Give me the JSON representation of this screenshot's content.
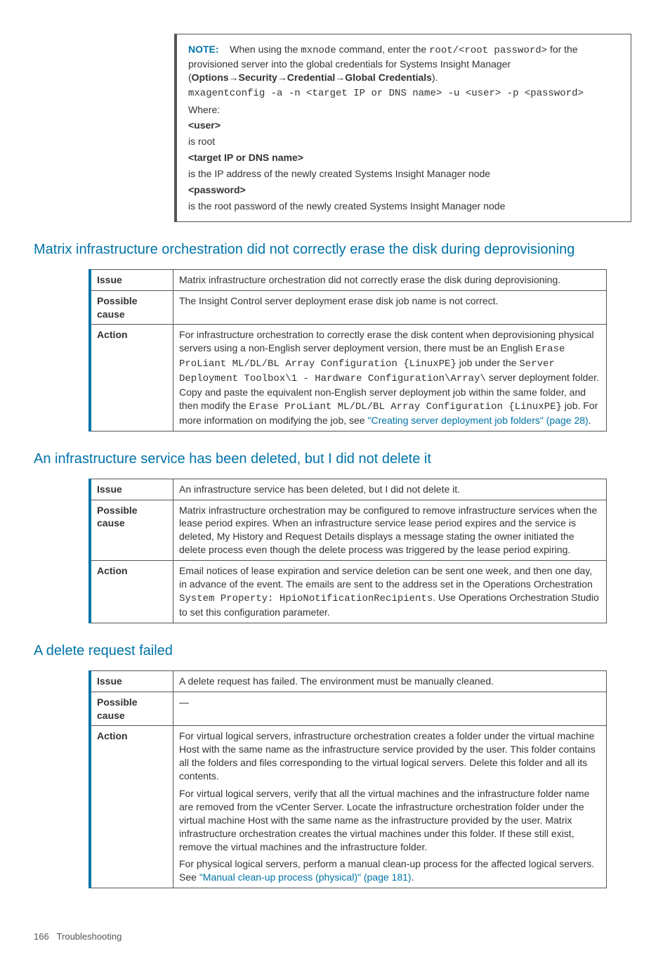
{
  "noteBox": {
    "notePrefix": "NOTE:",
    "noteLine1a": "When using the ",
    "noteCmd": "mxnode",
    "noteLine1b": " command, enter the ",
    "noteRoot": "root/<root password>",
    "noteLine1c": " for the provisioned server into the global credentials for Systems Insight Manager (",
    "notePath": "Options→Security→Credential→Global Credentials",
    "noteLine1d": ").",
    "cmd": "mxagentconfig -a -n <target IP or DNS name> -u <user> -p <password>",
    "where": "Where:",
    "userLabel": "<user>",
    "userDesc": "is root",
    "targetLabel": "<target IP or DNS name>",
    "targetDesc": "is the IP address of the newly created Systems Insight Manager node",
    "pwdLabel": "<password>",
    "pwdDesc": "is the root password of the newly created Systems Insight Manager node"
  },
  "labels": {
    "issue": "Issue",
    "cause": "Possible cause",
    "action": "Action"
  },
  "s1": {
    "title": "Matrix infrastructure orchestration did not correctly erase the disk during deprovisioning",
    "issue": "Matrix infrastructure orchestration did not correctly erase the disk during deprovisioning.",
    "cause": "The Insight Control server deployment erase disk job name is not correct.",
    "a_pre": "For infrastructure orchestration to correctly erase the disk content when deprovisioning physical servers using a non-English server deployment version, there must be an English ",
    "a_m1": "Erase ProLiant ML/DL/BL Array Configuration {LinuxPE}",
    "a_mid1": " job under the ",
    "a_m2": "Server Deployment Toolbox\\1 - Hardware Configuration\\Array\\",
    "a_mid2": " server deployment folder. Copy and paste the equivalent non-English server deployment job within the same folder, and then modify the ",
    "a_m3": "Erase ProLiant ML/DL/BL Array Configuration {LinuxPE}",
    "a_mid3": " job. For more information on modifying the job, see ",
    "a_link": "\"Creating server deployment job folders\" (page 28)",
    "a_end": "."
  },
  "s2": {
    "title": "An infrastructure service has been deleted, but I did not delete it",
    "issue": "An infrastructure service has been deleted, but I did not delete it.",
    "cause": "Matrix infrastructure orchestration may be configured to remove infrastructure services when the lease period expires. When an infrastructure service lease period expires and the service is deleted, My History and Request Details displays a message stating the owner initiated the delete process even though the delete process was triggered by the lease period expiring.",
    "a_pre": "Email notices of lease expiration and service deletion can be sent one week, and then one day, in advance of the event. The emails are sent to the address set in the Operations Orchestration ",
    "a_m1": "System Property: HpioNotificationRecipients",
    "a_end": ". Use Operations Orchestration Studio to set this configuration parameter."
  },
  "s3": {
    "title": "A delete request failed",
    "issue": "A delete request has failed. The environment must be manually cleaned.",
    "cause": "—",
    "p1": "For virtual logical servers, infrastructure orchestration creates a folder under the virtual machine Host with the same name as the infrastructure service provided by the user. This folder contains all the folders and files corresponding to the virtual logical servers. Delete this folder and all its contents.",
    "p2": "For virtual logical servers, verify that all the virtual machines and the infrastructure folder name are removed from the vCenter Server. Locate the infrastructure orchestration folder under the virtual machine Host with the same name as the infrastructure provided by the user. Matrix infrastructure orchestration creates the virtual machines under this folder. If these still exist, remove the virtual machines and the infrastructure folder.",
    "p3a": "For physical logical servers, perform a manual clean-up process for the affected logical servers. See ",
    "p3link": "\"Manual clean-up process (physical)\" (page 181)",
    "p3b": "."
  },
  "footer": {
    "page": "166",
    "section": "Troubleshooting"
  }
}
